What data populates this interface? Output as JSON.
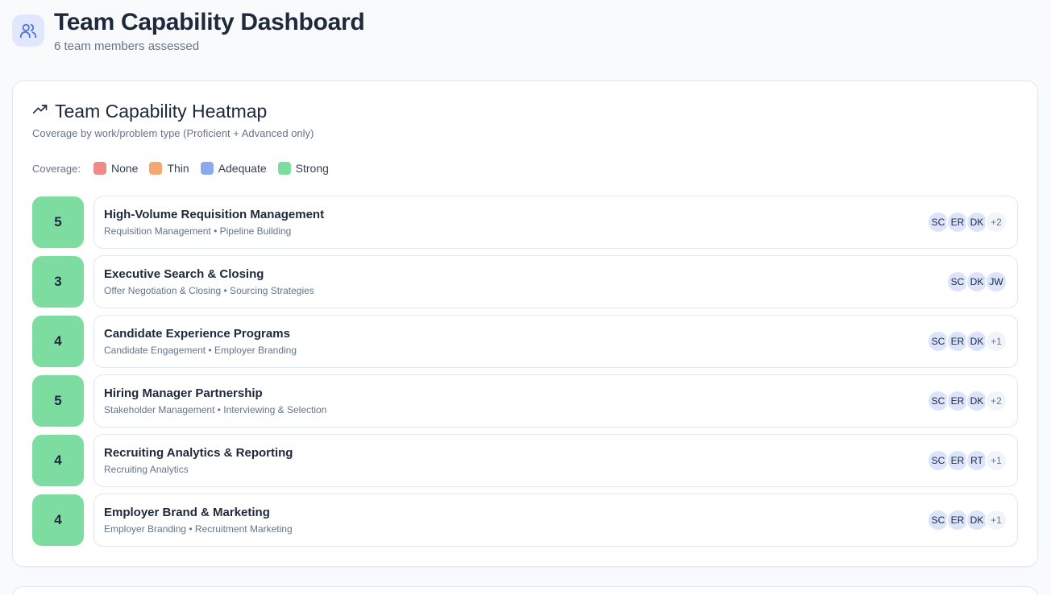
{
  "header": {
    "icon": "users-icon",
    "title": "Team Capability Dashboard",
    "subtitle": "6 team members assessed"
  },
  "heatmap": {
    "icon": "trending-up-icon",
    "title": "Team Capability Heatmap",
    "subtitle": "Coverage by work/problem type (Proficient + Advanced only)",
    "legend": {
      "label": "Coverage:",
      "items": [
        {
          "label": "None",
          "color": "#f08a8a"
        },
        {
          "label": "Thin",
          "color": "#f5a772"
        },
        {
          "label": "Adequate",
          "color": "#8aaaf0"
        },
        {
          "label": "Strong",
          "color": "#7ddc9f"
        }
      ]
    },
    "rows": [
      {
        "score": "5",
        "title": "High-Volume Requisition Management",
        "skills": "Requisition Management • Pipeline Building",
        "avatars": [
          "SC",
          "ER",
          "DK"
        ],
        "more": "+2"
      },
      {
        "score": "3",
        "title": "Executive Search & Closing",
        "skills": "Offer Negotiation & Closing • Sourcing Strategies",
        "avatars": [
          "SC",
          "DK",
          "JW"
        ],
        "more": ""
      },
      {
        "score": "4",
        "title": "Candidate Experience Programs",
        "skills": "Candidate Engagement • Employer Branding",
        "avatars": [
          "SC",
          "ER",
          "DK"
        ],
        "more": "+1"
      },
      {
        "score": "5",
        "title": "Hiring Manager Partnership",
        "skills": "Stakeholder Management • Interviewing & Selection",
        "avatars": [
          "SC",
          "ER",
          "DK"
        ],
        "more": "+2"
      },
      {
        "score": "4",
        "title": "Recruiting Analytics & Reporting",
        "skills": "Recruiting Analytics",
        "avatars": [
          "SC",
          "ER",
          "RT"
        ],
        "more": "+1"
      },
      {
        "score": "4",
        "title": "Employer Brand & Marketing",
        "skills": "Employer Branding • Recruitment Marketing",
        "avatars": [
          "SC",
          "ER",
          "DK"
        ],
        "more": "+1"
      }
    ]
  }
}
